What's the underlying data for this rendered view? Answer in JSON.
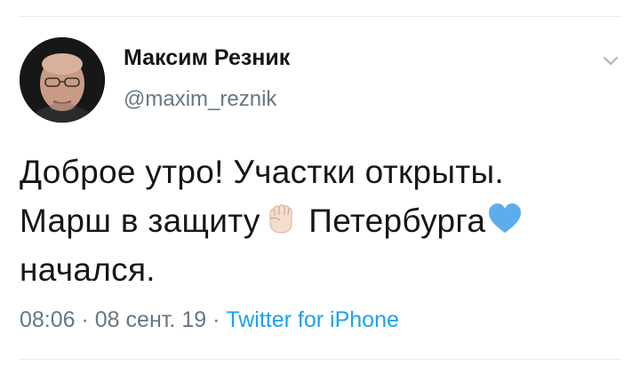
{
  "tweet": {
    "author": {
      "display_name": "Максим Резник",
      "handle": "@maxim_reznik",
      "avatar_icon": "profile-photo"
    },
    "menu_icon": "chevron-down-icon",
    "text_lines": {
      "line1": "Доброе утро! Участки открыты.",
      "line2_part1": "Марш в защиту",
      "line2_part2": " Петербурга",
      "line3": "начался."
    },
    "emojis": {
      "first": "raised-fist-light-skin-tone",
      "second": "blue-heart"
    },
    "meta": {
      "time": "08:06",
      "separator1": " · ",
      "date": "08 сент. 19",
      "separator2": " · ",
      "source": "Twitter for iPhone"
    },
    "colors": {
      "text": "#14171a",
      "secondary": "#657786",
      "link": "#1da1f2",
      "divider": "#e6ecf0"
    }
  }
}
